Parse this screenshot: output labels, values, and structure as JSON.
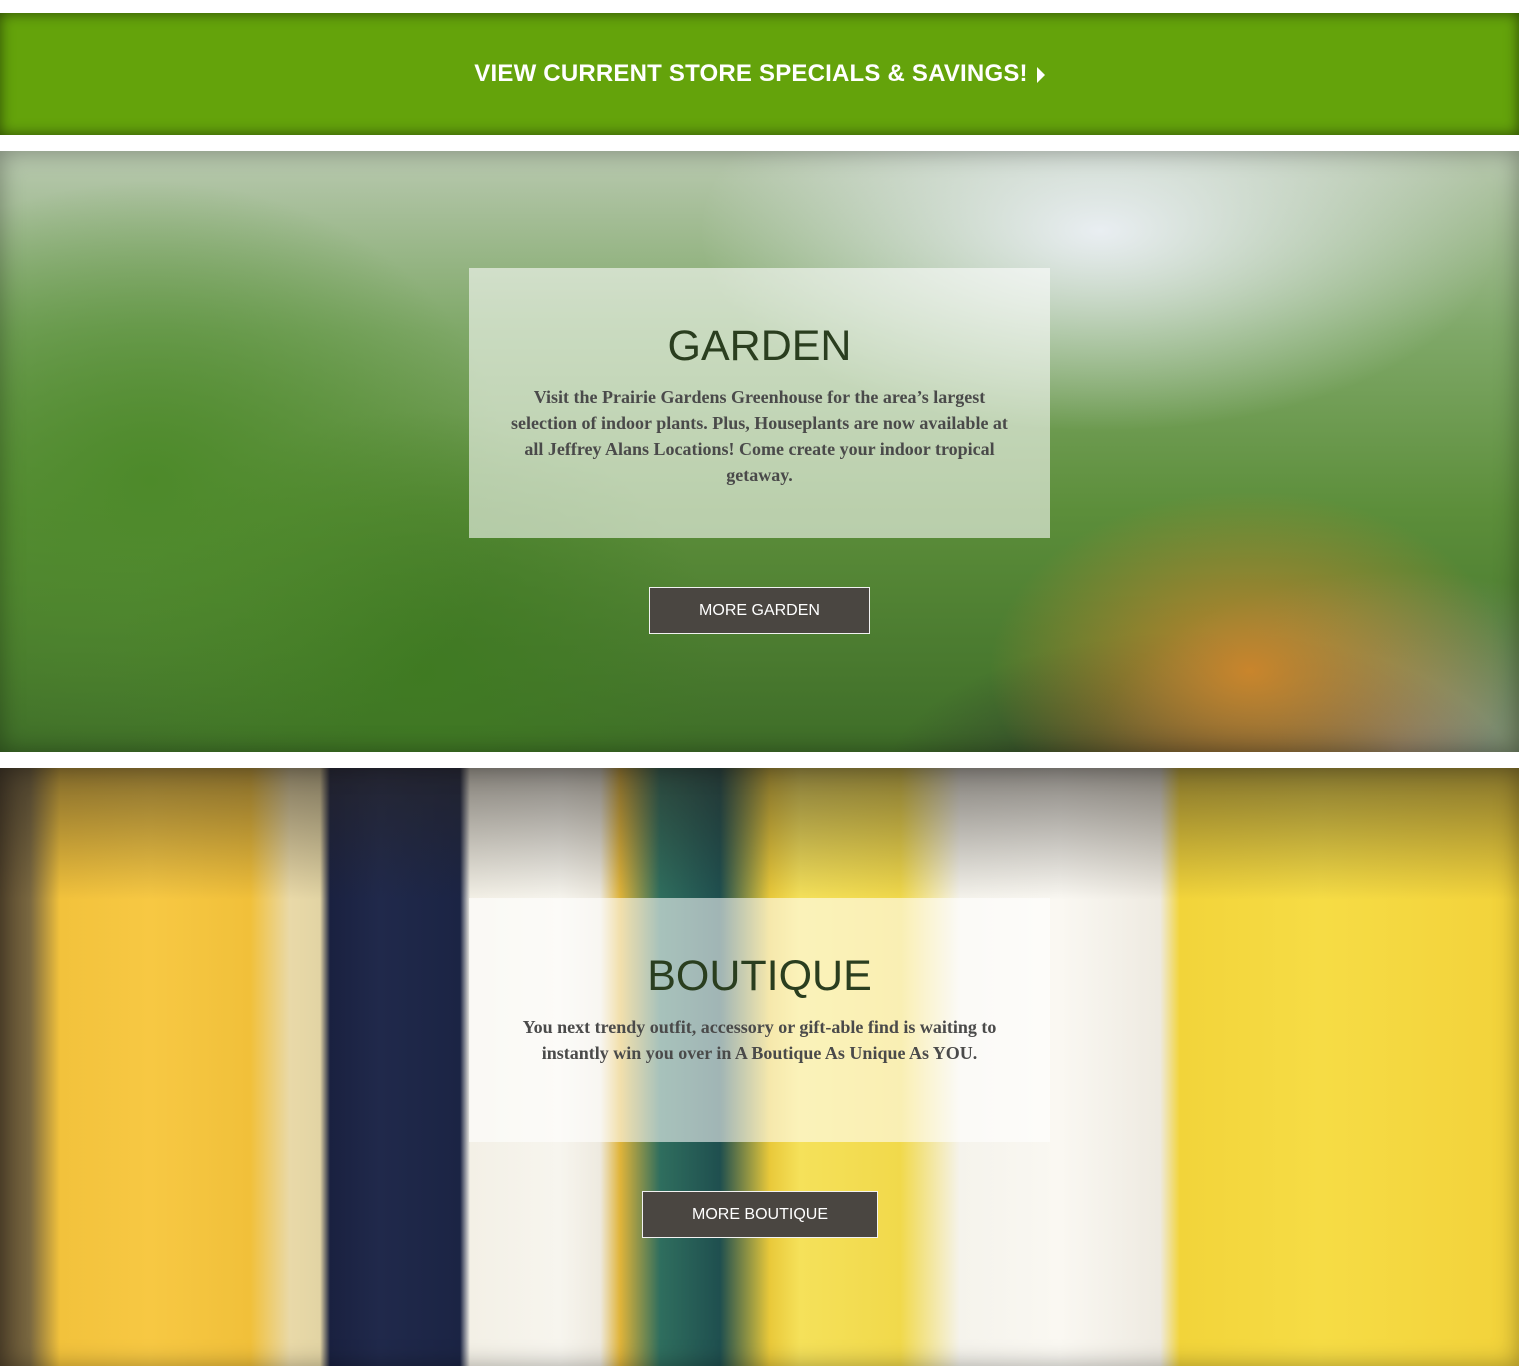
{
  "specials": {
    "label": "VIEW CURRENT STORE SPECIALS & SAVINGS!"
  },
  "garden": {
    "title": "GARDEN",
    "description": "Visit the Prairie Gardens Greenhouse for the area’s largest selection of indoor plants. Plus, Houseplants are now available at all Jeffrey Alans Locations! Come create your indoor tropical getaway.",
    "button_label": "MORE GARDEN"
  },
  "boutique": {
    "title": "BOUTIQUE",
    "description": "You next trendy outfit, accessory or gift-able find is waiting to instantly win you over in A Boutique As Unique As YOU.",
    "button_label": "MORE BOUTIQUE"
  },
  "colors": {
    "banner_green": "#64a30b",
    "button_dark": "#4a4641",
    "title_green": "#2a3e1f"
  },
  "icons": {
    "specials_caret": "caret-right-icon"
  }
}
